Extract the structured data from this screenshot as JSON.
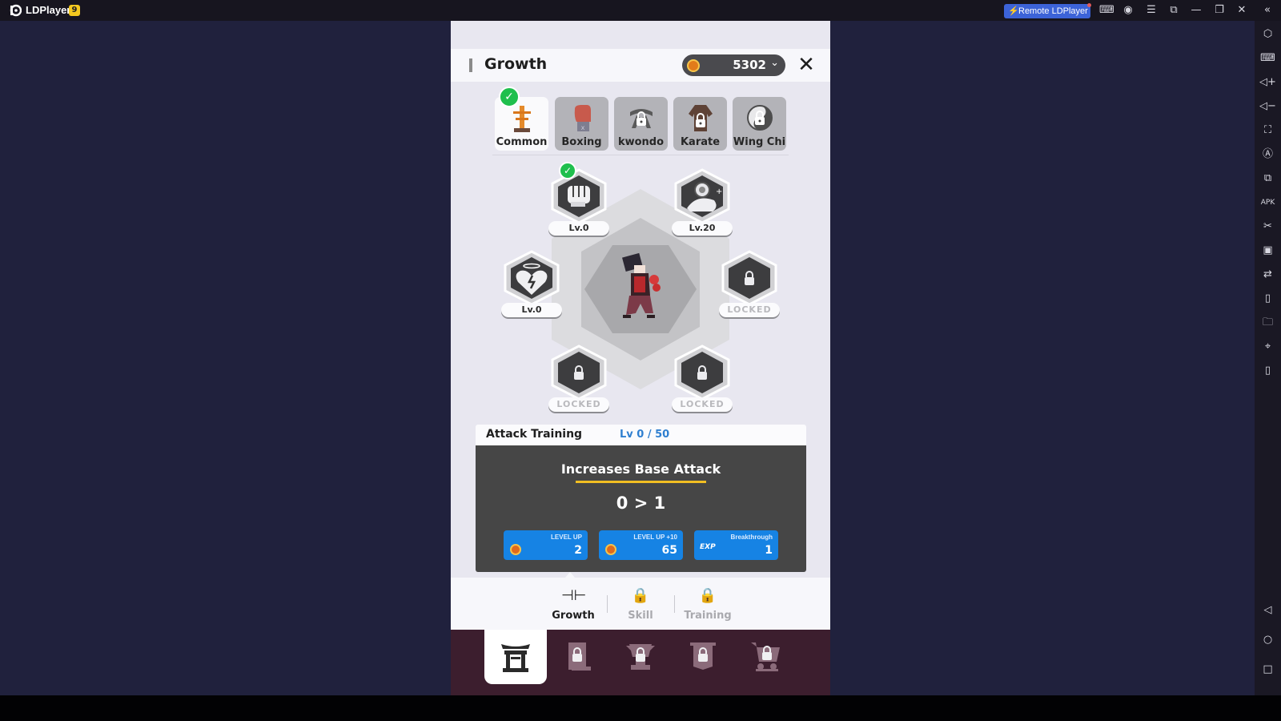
{
  "emulator": {
    "app_title": "LDPlayer",
    "version_badge": "9",
    "remote_button": "Remote LDPlayer",
    "titlebar_icons": [
      "gamepad-icon",
      "account-icon",
      "menu-icon",
      "window-resize-icon",
      "minimize-icon",
      "restore-icon",
      "close-icon",
      "collapse-sidebar-icon"
    ],
    "sidebar_icons": [
      "settings-hexagon-icon",
      "keyboard-icon",
      "volume-up-icon",
      "volume-down-icon",
      "screenshot-icon",
      "auto-rotate-icon",
      "multi-instance-icon",
      "apk-install-icon",
      "scissors-icon",
      "video-record-icon",
      "sync-icon",
      "shake-icon",
      "folder-icon",
      "location-icon",
      "rotate-device-icon"
    ],
    "android_nav": [
      "back-icon",
      "home-icon",
      "recents-icon"
    ]
  },
  "game": {
    "header": {
      "title": "Growth",
      "coins": "5302",
      "coin_color": "#e27b1a"
    },
    "style_tabs": [
      {
        "label": "Common",
        "active": true,
        "checked": true,
        "locked": false
      },
      {
        "label": "Boxing",
        "active": false,
        "checked": false,
        "locked": false
      },
      {
        "label": "kwondo",
        "active": false,
        "checked": false,
        "locked": true
      },
      {
        "label": "Karate",
        "active": false,
        "checked": false,
        "locked": true
      },
      {
        "label": "Wing Chi",
        "active": false,
        "checked": false,
        "locked": true
      }
    ],
    "skills": [
      {
        "name": "fist-attack",
        "level": "Lv.0",
        "locked": false,
        "checked": true
      },
      {
        "name": "muscle-strength",
        "level": "Lv.20",
        "locked": false,
        "checked": false
      },
      {
        "name": "heart-health",
        "level": "Lv.0",
        "locked": false,
        "checked": false
      },
      {
        "name": "locked-slot-right",
        "level": "LOCKED",
        "locked": true,
        "checked": false
      },
      {
        "name": "locked-slot-bottom-left",
        "level": "LOCKED",
        "locked": true,
        "checked": false
      },
      {
        "name": "locked-slot-bottom-right",
        "level": "LOCKED",
        "locked": true,
        "checked": false
      }
    ],
    "info": {
      "name": "Attack Training",
      "level": "Lv 0 / 50",
      "stat": "Increases Base Attack",
      "change": "0 > 1",
      "buttons": [
        {
          "title": "LEVEL UP",
          "cost": "2",
          "currency": "coin"
        },
        {
          "title": "LEVEL UP +10",
          "cost": "65",
          "currency": "coin"
        },
        {
          "title": "Breakthrough",
          "cost": "1",
          "currency": "exp"
        }
      ],
      "exp_label": "EXP"
    },
    "sub_tabs": [
      {
        "label": "Growth",
        "active": true,
        "locked": false
      },
      {
        "label": "Skill",
        "active": false,
        "locked": true
      },
      {
        "label": "Training",
        "active": false,
        "locked": true
      }
    ],
    "nav": [
      {
        "name": "dojo",
        "active": true,
        "locked": false
      },
      {
        "name": "scroll",
        "active": false,
        "locked": true
      },
      {
        "name": "versus-trophy",
        "active": false,
        "locked": true
      },
      {
        "name": "banner",
        "active": false,
        "locked": true
      },
      {
        "name": "shop-cart",
        "active": false,
        "locked": true
      }
    ]
  }
}
